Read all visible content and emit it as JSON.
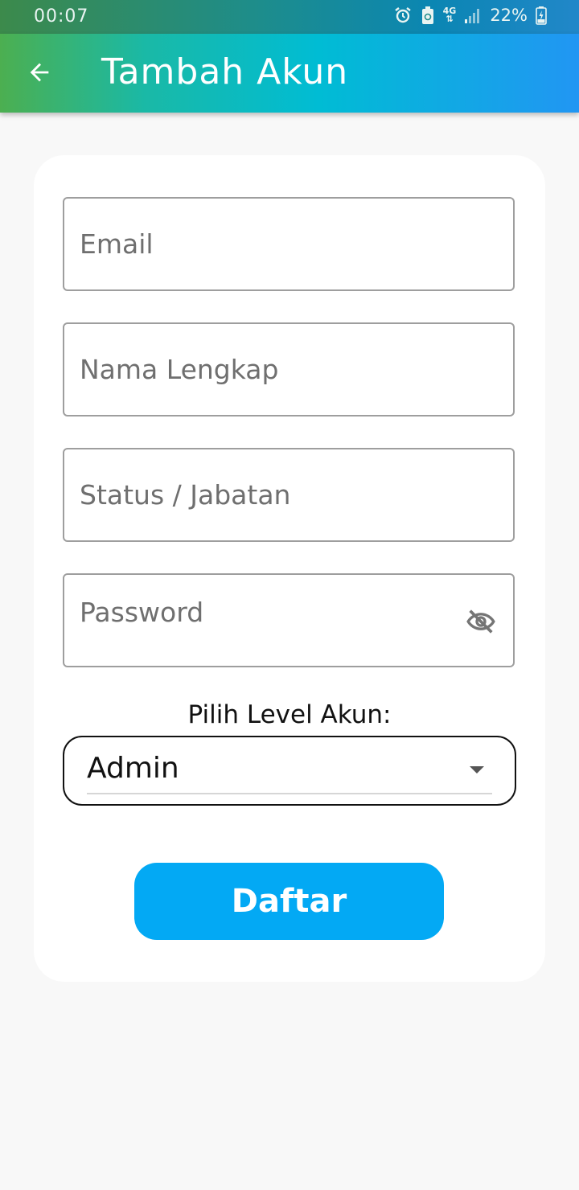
{
  "status_bar": {
    "time": "00:07",
    "network": "4G",
    "battery": "22%",
    "icons": [
      "alarm-icon",
      "battery-saver-icon",
      "network-4g-icon",
      "signal-icon",
      "battery-charging-icon"
    ]
  },
  "app_bar": {
    "title": "Tambah Akun",
    "back_icon": "arrow-left-icon",
    "gradient": [
      "#4caf50",
      "#00bcd4",
      "#2196f3"
    ]
  },
  "form": {
    "email_placeholder": "Email",
    "fullname_placeholder": "Nama Lengkap",
    "position_placeholder": "Status / Jabatan",
    "password_placeholder": "Password",
    "password_visibility_icon": "eye-off-icon",
    "level_label": "Pilih Level Akun:",
    "level_selected": "Admin",
    "level_dropdown_icon": "caret-down-icon",
    "submit_label": "Daftar",
    "submit_color": "#03a9f4"
  }
}
